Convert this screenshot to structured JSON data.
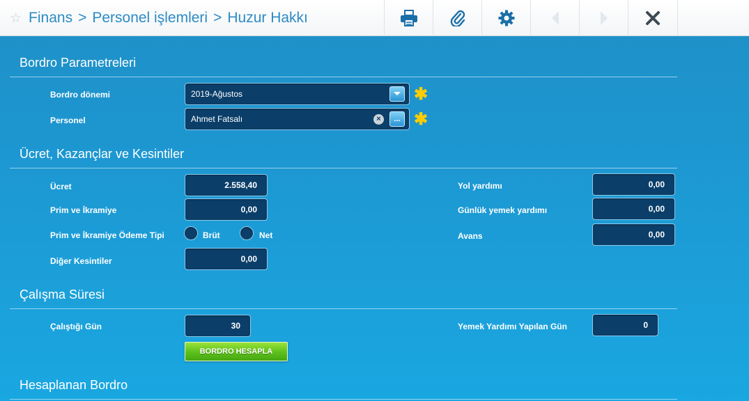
{
  "breadcrumb": {
    "items": [
      "Finans",
      "Personel işlemleri",
      "Huzur Hakkı"
    ],
    "separator": ">"
  },
  "toolbar": [
    "print-icon",
    "attach-icon",
    "settings-icon",
    "prev-icon",
    "next-icon",
    "close-icon"
  ],
  "sections": {
    "params": "Bordro Parametreleri",
    "wages": "Ücret, Kazançlar ve Kesintiler",
    "work": "Çalışma Süresi",
    "result": "Hesaplanan Bordro"
  },
  "params": {
    "period_label": "Bordro dönemi",
    "period_value": "2019-Ağustos",
    "personnel_label": "Personel",
    "personnel_value": "Ahmet Fatsalı",
    "required_mark": "✱"
  },
  "wages": {
    "ucret_label": "Ücret",
    "ucret_value": "2.558,40",
    "prim_label": "Prim ve İkramiye",
    "prim_value": "0,00",
    "prim_type_label": "Prim ve İkramiye Ödeme Tipi",
    "brut_label": "Brüt",
    "net_label": "Net",
    "diger_label": "Diğer Kesintiler",
    "diger_value": "0,00",
    "yol_label": "Yol yardımı",
    "yol_value": "0,00",
    "yemek_label": "Günlük yemek yardımı",
    "yemek_value": "0,00",
    "avans_label": "Avans",
    "avans_value": "0,00"
  },
  "work": {
    "gun_label": "Çalıştığı Gün",
    "gun_value": "30",
    "yemek_gun_label": "Yemek Yardımı Yapılan Gün",
    "yemek_gun_value": "0",
    "calc_button": "BORDRO HESAPLA"
  },
  "colors": {
    "accent": "#2c8bc3",
    "field_bg": "#0b3f6a",
    "required": "#ffcc00",
    "button_green": "#5cbf1c"
  }
}
